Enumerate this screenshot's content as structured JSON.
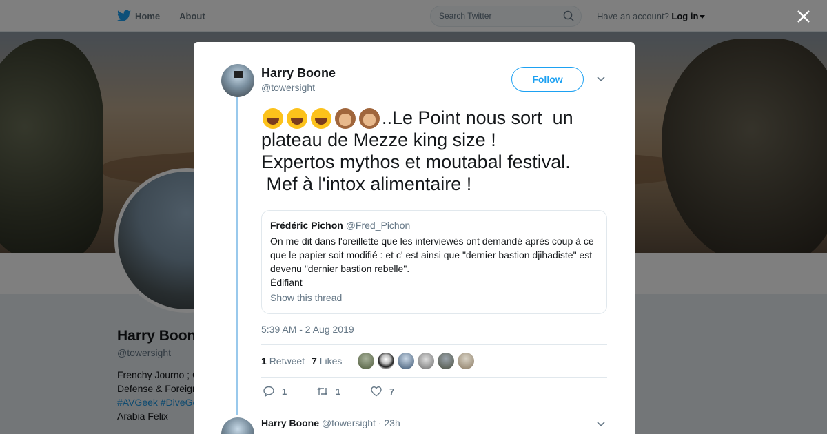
{
  "topbar": {
    "home_label": "Home",
    "about_label": "About",
    "search_placeholder": "Search Twitter",
    "account_prompt": "Have an account?",
    "login_label": "Log in"
  },
  "profile": {
    "name": "Harry Boone",
    "handle": "@towersight",
    "bio_line1": "Frenchy Journo ; C",
    "bio_line2": "Defense & Foreign",
    "bio_tag1": "#AVGeek",
    "bio_tag2": "#DiveGe",
    "bio_line4": "Arabia Felix"
  },
  "tweet": {
    "author_name": "Harry Boone",
    "author_handle": "@towersight",
    "follow_label": "Follow",
    "text_line1": "..Le Point nous sort  un",
    "text_line2": "plateau de Mezze king size !",
    "text_line3": "Expertos mythos et moutabal festival.",
    "text_line4": " Mef à l'intox alimentaire !",
    "emojis": [
      "face-with-tears-of-joy",
      "face-with-tears-of-joy",
      "face-with-tears-of-joy",
      "see-no-evil-monkey",
      "see-no-evil-monkey"
    ],
    "quote": {
      "name": "Frédéric Pichon",
      "handle": "@Fred_Pichon",
      "body": "On me dit dans l'oreillette que les interviewés ont demandé après coup à ce que le papier soit modifié : et c' est ainsi que \"dernier bastion djihadiste\" est devenu \"dernier bastion rebelle\".",
      "body_line2": "Édifiant",
      "show_thread": "Show this thread"
    },
    "timestamp": "5:39 AM - 2 Aug 2019",
    "retweet_count": "1",
    "retweet_label": "Retweet",
    "like_count": "7",
    "like_label": "Likes",
    "reply_action_count": "1",
    "retweet_action_count": "1",
    "like_action_count": "7"
  },
  "reply": {
    "name": "Harry Boone",
    "handle": "@towersight",
    "time": "· 23h"
  },
  "colors": {
    "twitter_blue": "#1da1f2",
    "thread_line": "#99c9ec",
    "muted_text": "#657786"
  }
}
